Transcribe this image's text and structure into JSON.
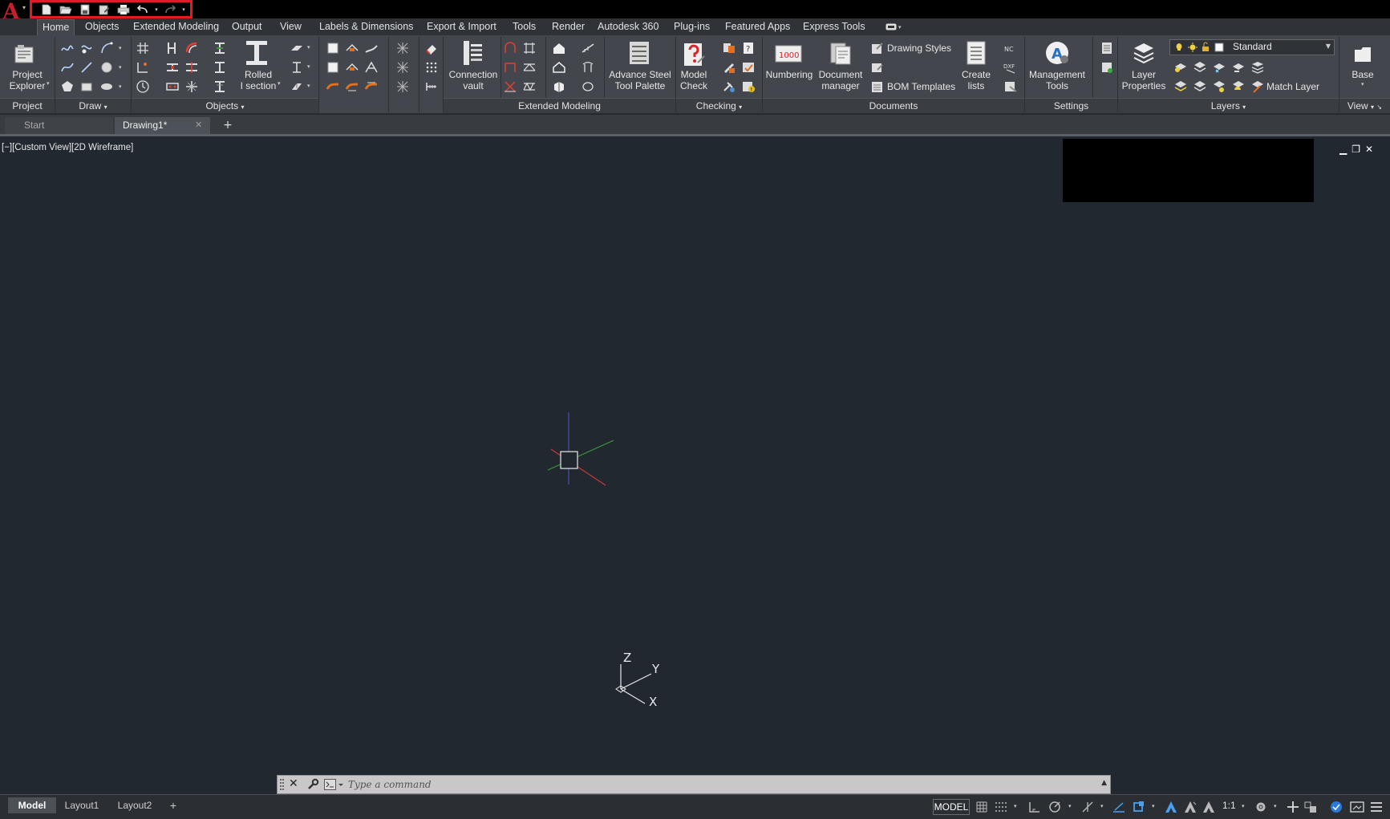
{
  "app": {
    "logo_letter": "A",
    "logo_color": "#c8202a"
  },
  "qat": {
    "items": [
      "new-icon",
      "open-icon",
      "save-icon",
      "save-as-icon",
      "plot-icon",
      "undo-icon",
      "redo-icon"
    ],
    "highlight_color": "#e01b24"
  },
  "ribbon_tabs": [
    "Home",
    "Objects",
    "Extended Modeling",
    "Output",
    "View",
    "Labels & Dimensions",
    "Export & Import",
    "Tools",
    "Render",
    "Autodesk 360",
    "Plug-ins",
    "Featured Apps",
    "Express Tools"
  ],
  "panels": {
    "project": {
      "footer": "Project",
      "project_explorer": "Project\nExplorer"
    },
    "draw": {
      "footer": "Draw"
    },
    "objects": {
      "footer": "Objects",
      "rolled_section": "Rolled\nI section"
    },
    "extended": {
      "footer": "Extended Modeling",
      "connection_vault": "Connection\nvault",
      "tool_palette": "Advance Steel\nTool Palette"
    },
    "checking": {
      "footer": "Checking",
      "model_check": "Model\nCheck"
    },
    "documents": {
      "footer": "Documents",
      "numbering": "Numbering",
      "numbering_badge": "1000",
      "document_manager": "Document\nmanager",
      "drawing_styles": "Drawing Styles",
      "bom_templates": "BOM Templates",
      "create_lists": "Create\nlists"
    },
    "settings": {
      "footer": "Settings",
      "management_tools": "Management\nTools"
    },
    "layers": {
      "footer": "Layers",
      "layer_properties": "Layer\nProperties",
      "layer_dropdown": "Standard",
      "match_layer": "Match Layer"
    },
    "view": {
      "footer": "View",
      "base": "Base"
    }
  },
  "file_tabs": {
    "start": "Start",
    "drawing": "Drawing1*"
  },
  "viewport": {
    "label": "[−][Custom View][2D Wireframe]",
    "ucs_labels": {
      "z": "Z",
      "y": "Y",
      "x": "X"
    }
  },
  "command_line": {
    "placeholder": "Type a command"
  },
  "layout_tabs": [
    "Model",
    "Layout1",
    "Layout2"
  ],
  "status": {
    "model": "MODEL",
    "scale": "1:1"
  }
}
